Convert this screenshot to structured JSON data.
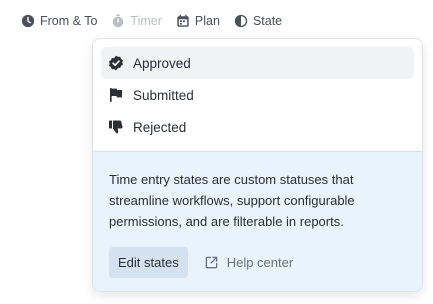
{
  "toolbar": {
    "items": [
      {
        "label": "From & To",
        "icon": "clock-icon",
        "disabled": false
      },
      {
        "label": "Timer",
        "icon": "stopwatch-icon",
        "disabled": true
      },
      {
        "label": "Plan",
        "icon": "calendar-icon",
        "disabled": false
      },
      {
        "label": "State",
        "icon": "half-circle-icon",
        "disabled": false
      }
    ]
  },
  "state_menu": {
    "options": [
      {
        "label": "Approved",
        "icon": "check-badge-icon",
        "selected": true
      },
      {
        "label": "Submitted",
        "icon": "flag-icon",
        "selected": false
      },
      {
        "label": "Rejected",
        "icon": "thumbs-down-icon",
        "selected": false
      }
    ],
    "info_text": "Time entry states are custom statuses that streamline workflows, support configurable permissions, and are filterable in reports.",
    "edit_button_label": "Edit states",
    "help_link_label": "Help center"
  },
  "colors": {
    "info_background": "#e8f3fb",
    "edit_button_background": "#d3e2ee",
    "selected_row_background": "#f1f2f4"
  }
}
